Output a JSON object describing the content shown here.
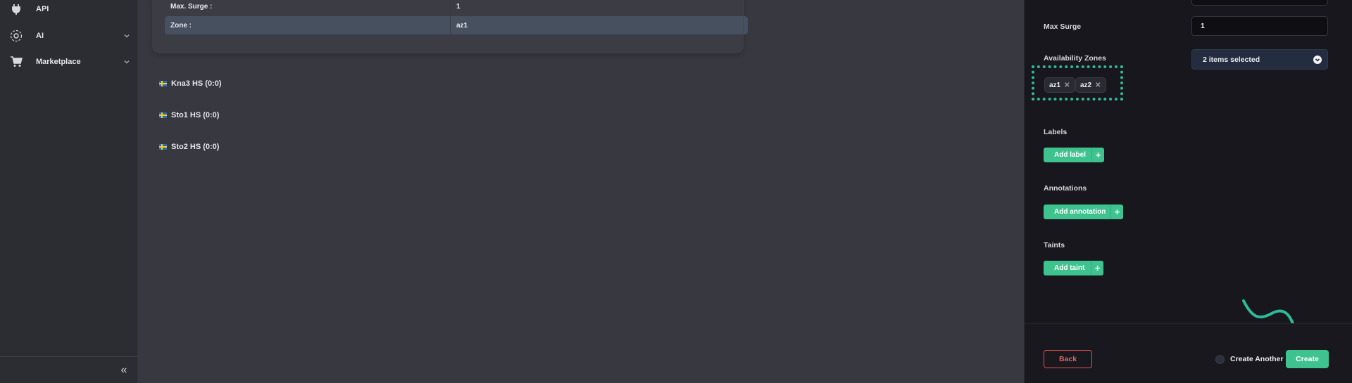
{
  "sidebar": {
    "items": [
      {
        "label": "API",
        "icon": "plug-icon"
      },
      {
        "label": "AI",
        "icon": "ai-network-icon",
        "has_chevron": true
      },
      {
        "label": "Marketplace",
        "icon": "cart-icon",
        "has_chevron": true
      }
    ],
    "collapse_glyph": "«"
  },
  "details": {
    "rows": [
      {
        "key": "Max. Surge :",
        "value": "1"
      },
      {
        "key": "Zone :",
        "value": "az1"
      }
    ]
  },
  "regions": [
    {
      "label": "Kna3 HS (0:0)"
    },
    {
      "label": "Sto1 HS (0:0)"
    },
    {
      "label": "Sto2 HS (0:0)"
    }
  ],
  "form": {
    "max_surge_label": "Max Surge",
    "max_surge_value": "1",
    "zones_label": "Availability Zones",
    "zones_select_text": "2 items selected",
    "zone_chips": [
      "az1",
      "az2"
    ],
    "chip_remove_glyph": "✕",
    "labels_heading": "Labels",
    "add_label": "Add label",
    "annotations_heading": "Annotations",
    "add_annotation": "Add annotation",
    "taints_heading": "Taints",
    "add_taint": "Add taint",
    "plus_glyph": "+"
  },
  "footer": {
    "back_label": "Back",
    "create_another_label": "Create Another",
    "create_another_checked": false,
    "create_label": "Create"
  },
  "colors": {
    "accent_green": "#3ec38f",
    "highlight_teal": "#2dbb9a",
    "danger_red": "#d9544c",
    "drawer_bg": "#17171d",
    "main_bg": "#383841"
  }
}
